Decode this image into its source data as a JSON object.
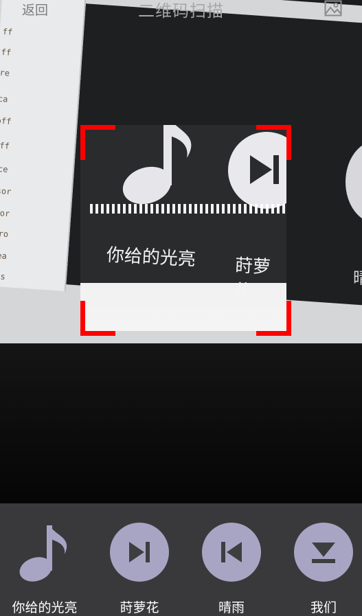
{
  "header": {
    "back_label": "返回",
    "title": "二维码扫描",
    "album_icon": "image-gallery-icon"
  },
  "camera_preview": {
    "code_fragments": [
      "ff",
      "ff",
      "re",
      "ca",
      "off",
      "off",
      "rce",
      "nsor",
      "nsor",
      "_pro",
      "hrea",
      "ages"
    ],
    "screen_labels": [
      "你给的光亮",
      "莳萝花",
      "晴"
    ],
    "icons": [
      "music-note-icon",
      "skip-next-icon"
    ]
  },
  "scanner": {
    "frame_color": "#ff0000",
    "scan_line_color": "#ffffff"
  },
  "playlist": {
    "background": "#3e3e40",
    "icon_color": "#a8a5c4",
    "items": [
      {
        "label": "你给的光亮",
        "icon": "music-note-icon"
      },
      {
        "label": "莳萝花",
        "icon": "skip-next-icon"
      },
      {
        "label": "晴雨",
        "icon": "skip-previous-icon"
      },
      {
        "label": "我们",
        "icon": "eject-down-icon"
      }
    ]
  }
}
